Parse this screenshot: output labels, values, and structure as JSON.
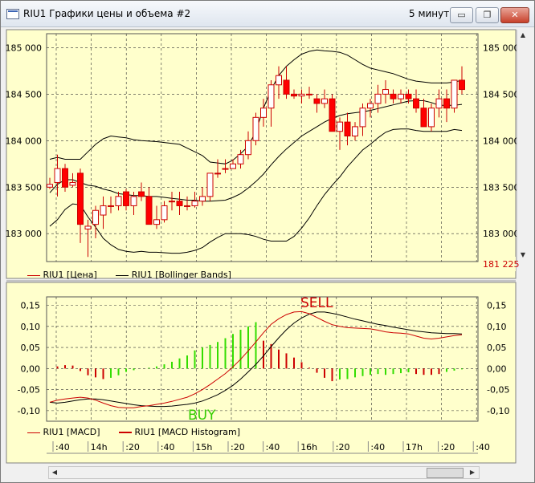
{
  "window": {
    "title": "RIU1 Графики цены и объема #2",
    "period": "5 минут",
    "buttons": {
      "minimize": "▭",
      "restore": "❐",
      "close": "✕"
    }
  },
  "colors": {
    "chart_bg": "#ffffcc",
    "up": "#ffffff",
    "down": "#ff0000",
    "candle_border": "#cc0000",
    "bb": "#000000",
    "hist_pos": "#33dd00",
    "hist_neg": "#cc0000",
    "buy": "#33cc00",
    "sell": "#cc0000"
  },
  "chart_data": [
    {
      "type": "candlestick",
      "name": "price",
      "y_ticks": [
        "185 000",
        "184 500",
        "184 000",
        "183 500",
        "183 000"
      ],
      "y_tick_values": [
        185000,
        184500,
        184000,
        183500,
        183000
      ],
      "ylim": [
        182700,
        185150
      ],
      "last_value_label": "181 225",
      "ohlc": [
        [
          183500,
          183600,
          183480,
          183530
        ],
        [
          183550,
          183850,
          183400,
          183700
        ],
        [
          183700,
          183750,
          183450,
          183500
        ],
        [
          183520,
          183650,
          183500,
          183550
        ],
        [
          183650,
          183700,
          182900,
          183100
        ],
        [
          183050,
          183150,
          182750,
          183080
        ],
        [
          183100,
          183300,
          182950,
          183250
        ],
        [
          183200,
          183400,
          183050,
          183300
        ],
        [
          183300,
          183400,
          183220,
          183300
        ],
        [
          183300,
          183450,
          183250,
          183400
        ],
        [
          183450,
          183480,
          183250,
          183300
        ],
        [
          183300,
          183450,
          183200,
          183400
        ],
        [
          183450,
          183550,
          183350,
          183400
        ],
        [
          183400,
          183500,
          183100,
          183100
        ],
        [
          183100,
          183300,
          183050,
          183150
        ],
        [
          183150,
          183350,
          183120,
          183300
        ],
        [
          183350,
          183450,
          183250,
          183350
        ],
        [
          183350,
          183450,
          183200,
          183300
        ],
        [
          183300,
          183400,
          183250,
          183300
        ],
        [
          183300,
          183450,
          183280,
          183350
        ],
        [
          183350,
          183500,
          183300,
          183400
        ],
        [
          183400,
          183650,
          183350,
          183650
        ],
        [
          183650,
          183800,
          183600,
          183650
        ],
        [
          183700,
          183800,
          183650,
          183700
        ],
        [
          183700,
          183800,
          183700,
          183750
        ],
        [
          183750,
          183900,
          183700,
          183850
        ],
        [
          183850,
          184100,
          183800,
          184000
        ],
        [
          184000,
          184300,
          183950,
          184250
        ],
        [
          184250,
          184450,
          184150,
          184350
        ],
        [
          184350,
          184650,
          184150,
          184600
        ],
        [
          184600,
          184800,
          184450,
          184700
        ],
        [
          184650,
          184800,
          184450,
          184500
        ],
        [
          184500,
          184550,
          184450,
          184480
        ],
        [
          184480,
          184550,
          184400,
          184500
        ],
        [
          184500,
          184580,
          184450,
          184500
        ],
        [
          184450,
          184500,
          184300,
          184400
        ],
        [
          184400,
          184550,
          184350,
          184450
        ],
        [
          184450,
          184500,
          184100,
          184100
        ],
        [
          184100,
          184250,
          183900,
          184200
        ],
        [
          184200,
          184300,
          183950,
          184050
        ],
        [
          184050,
          184200,
          184000,
          184150
        ],
        [
          184150,
          184400,
          184050,
          184350
        ],
        [
          184350,
          184450,
          184250,
          184400
        ],
        [
          184400,
          184600,
          184300,
          184500
        ],
        [
          184500,
          184650,
          184400,
          184550
        ],
        [
          184500,
          184550,
          184400,
          184450
        ],
        [
          184450,
          184550,
          184400,
          184500
        ],
        [
          184500,
          184550,
          184400,
          184450
        ],
        [
          184450,
          184550,
          184300,
          184350
        ],
        [
          184350,
          184450,
          184150,
          184150
        ],
        [
          184150,
          184400,
          184100,
          184350
        ],
        [
          184350,
          184550,
          184250,
          184450
        ],
        [
          184450,
          184550,
          184200,
          184350
        ],
        [
          184350,
          184600,
          184300,
          184650
        ],
        [
          184650,
          184800,
          184500,
          184550
        ]
      ],
      "bollinger_upper": [
        183800,
        183820,
        183800,
        183800,
        183800,
        183880,
        183960,
        184020,
        184050,
        184040,
        184030,
        184010,
        184000,
        183995,
        183990,
        183980,
        183970,
        183960,
        183920,
        183880,
        183840,
        183770,
        183760,
        183750,
        183790,
        183860,
        183940,
        184100,
        184350,
        184550,
        184700,
        184800,
        184870,
        184930,
        184960,
        184975,
        184965,
        184960,
        184950,
        184920,
        184870,
        184820,
        184780,
        184760,
        184740,
        184720,
        184690,
        184660,
        184640,
        184630,
        184620,
        184620,
        184620,
        184630,
        184650
      ],
      "bollinger_middle": [
        183440,
        183530,
        183580,
        183580,
        183550,
        183520,
        183510,
        183480,
        183460,
        183430,
        183420,
        183410,
        183410,
        183400,
        183400,
        183390,
        183380,
        183370,
        183360,
        183360,
        183350,
        183350,
        183355,
        183360,
        183390,
        183430,
        183490,
        183560,
        183640,
        183740,
        183830,
        183910,
        183980,
        184050,
        184100,
        184150,
        184200,
        184240,
        184270,
        184290,
        184300,
        184310,
        184325,
        184345,
        184365,
        184385,
        184405,
        184425,
        184430,
        184430,
        184410,
        184380,
        184380,
        184380,
        184390
      ],
      "bollinger_lower": [
        183080,
        183150,
        183260,
        183320,
        183310,
        183180,
        183070,
        182950,
        182880,
        182830,
        182810,
        182800,
        182810,
        182800,
        182800,
        182795,
        182790,
        182790,
        182800,
        182820,
        182850,
        182910,
        182960,
        183000,
        183000,
        183000,
        182990,
        182970,
        182940,
        182920,
        182920,
        182920,
        182970,
        183060,
        183170,
        183300,
        183420,
        183520,
        183610,
        183720,
        183810,
        183900,
        183960,
        184030,
        184090,
        184120,
        184125,
        184125,
        184110,
        184100,
        184100,
        184100,
        184100,
        184120,
        184110
      ]
    },
    {
      "type": "line",
      "name": "macd",
      "y_ticks": [
        "0,15",
        "0,10",
        "0,05",
        "0,00",
        "-0,05",
        "-0,10"
      ],
      "y_tick_values": [
        0.15,
        0.1,
        0.05,
        0.0,
        -0.05,
        -0.1
      ],
      "ylim": [
        -0.125,
        0.17
      ],
      "macd": [
        -0.08,
        -0.075,
        -0.072,
        -0.07,
        -0.068,
        -0.07,
        -0.075,
        -0.082,
        -0.088,
        -0.092,
        -0.093,
        -0.093,
        -0.09,
        -0.088,
        -0.085,
        -0.082,
        -0.078,
        -0.073,
        -0.068,
        -0.06,
        -0.05,
        -0.038,
        -0.025,
        -0.012,
        0.004,
        0.022,
        0.042,
        0.063,
        0.085,
        0.105,
        0.118,
        0.128,
        0.134,
        0.135,
        0.13,
        0.121,
        0.112,
        0.104,
        0.1,
        0.097,
        0.096,
        0.095,
        0.094,
        0.091,
        0.087,
        0.085,
        0.084,
        0.082,
        0.077,
        0.072,
        0.07,
        0.072,
        0.075,
        0.078,
        0.08
      ],
      "signal": [
        -0.08,
        -0.082,
        -0.08,
        -0.077,
        -0.074,
        -0.072,
        -0.072,
        -0.074,
        -0.077,
        -0.08,
        -0.083,
        -0.086,
        -0.088,
        -0.089,
        -0.09,
        -0.09,
        -0.089,
        -0.087,
        -0.085,
        -0.082,
        -0.077,
        -0.07,
        -0.062,
        -0.052,
        -0.04,
        -0.025,
        -0.008,
        0.01,
        0.03,
        0.052,
        0.073,
        0.092,
        0.108,
        0.12,
        0.129,
        0.134,
        0.134,
        0.131,
        0.127,
        0.122,
        0.117,
        0.113,
        0.109,
        0.105,
        0.102,
        0.098,
        0.095,
        0.092,
        0.089,
        0.087,
        0.085,
        0.084,
        0.083,
        0.083,
        0.082
      ],
      "histogram": [
        0.0,
        0.005,
        0.008,
        0.007,
        -0.006,
        -0.016,
        -0.021,
        -0.025,
        -0.022,
        -0.016,
        -0.008,
        -0.004,
        0.0,
        0.002,
        0.005,
        0.01,
        0.016,
        0.024,
        0.031,
        0.043,
        0.05,
        0.056,
        0.063,
        0.072,
        0.082,
        0.092,
        0.1,
        0.11,
        0.066,
        0.058,
        0.045,
        0.036,
        0.026,
        0.015,
        0.002,
        -0.01,
        -0.022,
        -0.03,
        -0.026,
        -0.025,
        -0.021,
        -0.018,
        -0.015,
        -0.013,
        -0.015,
        -0.013,
        -0.011,
        -0.009,
        -0.013,
        -0.015,
        -0.015,
        -0.013,
        -0.008,
        -0.005,
        -0.002
      ],
      "hist_colors": [
        "n",
        "n",
        "n",
        "n",
        "n",
        "n",
        "n",
        "n",
        "p",
        "p",
        "p",
        "p",
        "p",
        "p",
        "p",
        "p",
        "p",
        "p",
        "p",
        "p",
        "p",
        "p",
        "p",
        "p",
        "p",
        "p",
        "p",
        "p",
        "n",
        "n",
        "n",
        "n",
        "n",
        "n",
        "n",
        "n",
        "n",
        "n",
        "p",
        "p",
        "p",
        "p",
        "p",
        "p",
        "p",
        "p",
        "p",
        "p",
        "n",
        "n",
        "n",
        "n",
        "p",
        "p",
        "p"
      ],
      "annotations": [
        "BUY",
        "SELL"
      ]
    }
  ],
  "legends": {
    "price": [
      "RIU1 [Цена]",
      "RIU1 [Bollinger Bands]"
    ],
    "macd": [
      "RIU1 [MACD]",
      "RIU1 [MACD Histogram]"
    ]
  },
  "time_axis": [
    ":40",
    "14h",
    ":20",
    ":40",
    "15h",
    ":20",
    ":40",
    "16h",
    ":20",
    ":40",
    "17h",
    ":20",
    ":40"
  ]
}
